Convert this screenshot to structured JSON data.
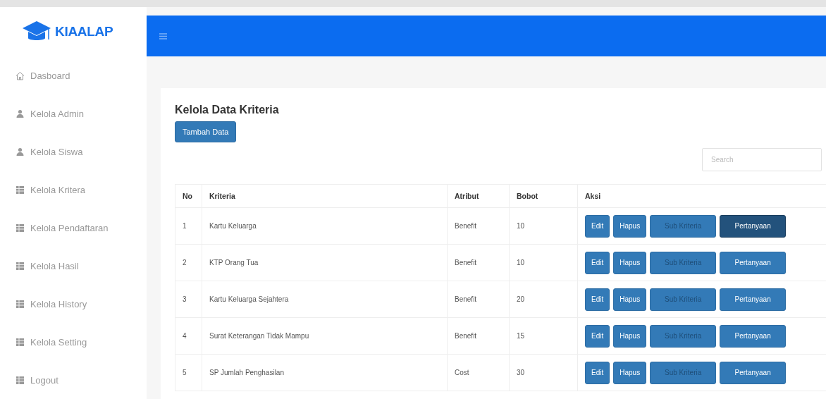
{
  "brand": {
    "name": "KIAALAP"
  },
  "sidebar": {
    "items": [
      {
        "label": "Dasboard",
        "kind": "home"
      },
      {
        "label": "Kelola Admin",
        "kind": "user"
      },
      {
        "label": "Kelola Siswa",
        "kind": "user"
      },
      {
        "label": "Kelola Kritera",
        "kind": "table"
      },
      {
        "label": "Kelola Pendaftaran",
        "kind": "table"
      },
      {
        "label": "Kelola Hasil",
        "kind": "table"
      },
      {
        "label": "Kelola History",
        "kind": "table"
      },
      {
        "label": "Kelola Setting",
        "kind": "table"
      },
      {
        "label": "Logout",
        "kind": "table"
      }
    ]
  },
  "page": {
    "title": "Kelola Data Kriteria",
    "add_button": "Tambah Data"
  },
  "search": {
    "placeholder": "Search"
  },
  "table": {
    "columns": [
      "No",
      "Kriteria",
      "Atribut",
      "Bobot",
      "Aksi"
    ],
    "rows": [
      {
        "cells": [
          "1",
          "Kartu Keluarga",
          "Benefit",
          "10"
        ],
        "actions": [
          {
            "label": "Edit",
            "kind": "edit",
            "focused": false
          },
          {
            "label": "Hapus",
            "kind": "delete",
            "focused": false
          },
          {
            "label": "Sub Kriteria",
            "kind": "sub",
            "focused": false
          },
          {
            "label": "Pertanyaan",
            "kind": "question",
            "focused": true
          }
        ]
      },
      {
        "cells": [
          "2",
          "KTP Orang Tua",
          "Benefit",
          "10"
        ],
        "actions": [
          {
            "label": "Edit",
            "kind": "edit",
            "focused": false
          },
          {
            "label": "Hapus",
            "kind": "delete",
            "focused": false
          },
          {
            "label": "Sub Kriteria",
            "kind": "sub",
            "focused": false
          },
          {
            "label": "Pertanyaan",
            "kind": "question",
            "focused": false
          }
        ]
      },
      {
        "cells": [
          "3",
          "Kartu Keluarga Sejahtera",
          "Benefit",
          "20"
        ],
        "actions": [
          {
            "label": "Edit",
            "kind": "edit",
            "focused": false
          },
          {
            "label": "Hapus",
            "kind": "delete",
            "focused": false
          },
          {
            "label": "Sub Kriteria",
            "kind": "sub",
            "focused": false
          },
          {
            "label": "Pertanyaan",
            "kind": "question",
            "focused": false
          }
        ]
      },
      {
        "cells": [
          "4",
          "Surat Keterangan Tidak Mampu",
          "Benefit",
          "15"
        ],
        "actions": [
          {
            "label": "Edit",
            "kind": "edit",
            "focused": false
          },
          {
            "label": "Hapus",
            "kind": "delete",
            "focused": false
          },
          {
            "label": "Sub Kriteria",
            "kind": "sub",
            "focused": false
          },
          {
            "label": "Pertanyaan",
            "kind": "question",
            "focused": false
          }
        ]
      },
      {
        "cells": [
          "5",
          "SP Jumlah Penghasilan",
          "Cost",
          "30"
        ],
        "actions": [
          {
            "label": "Edit",
            "kind": "edit",
            "focused": false
          },
          {
            "label": "Hapus",
            "kind": "delete",
            "focused": false
          },
          {
            "label": "Sub Kriteria",
            "kind": "sub",
            "focused": false
          },
          {
            "label": "Pertanyaan",
            "kind": "question",
            "focused": false
          }
        ]
      }
    ]
  }
}
